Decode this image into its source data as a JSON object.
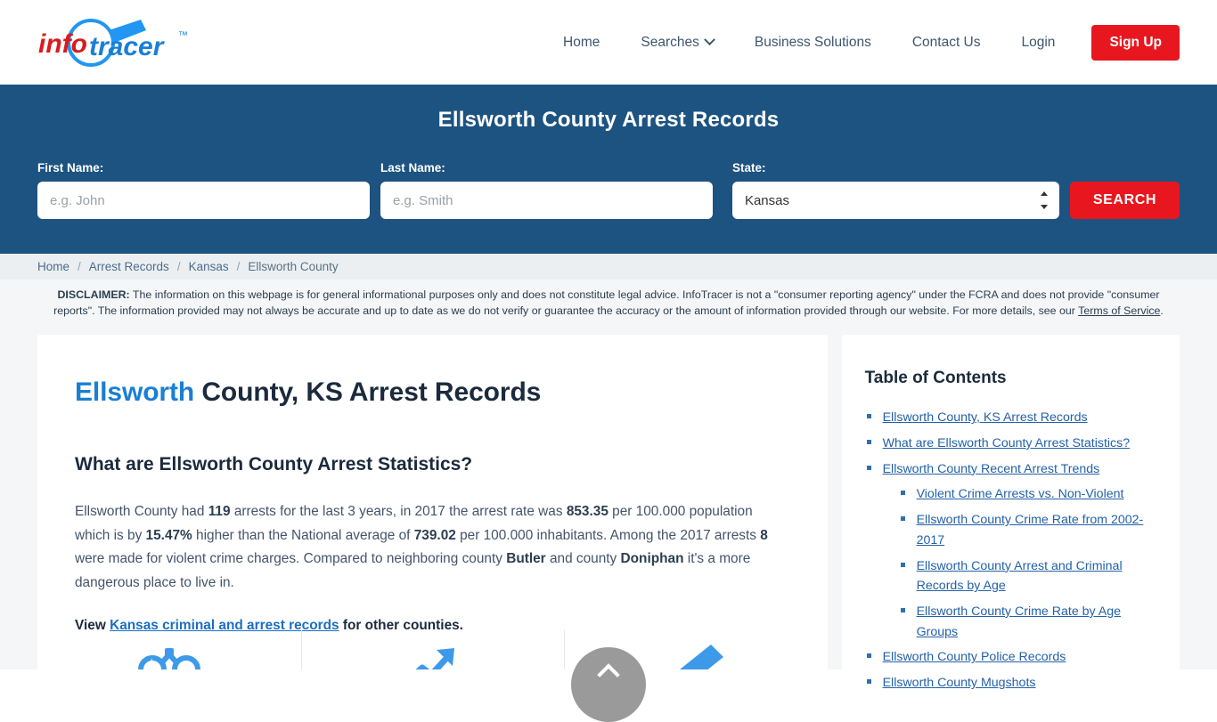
{
  "brand": {
    "name_info": "info",
    "name_tracer": "tracer",
    "tm": "™"
  },
  "nav": {
    "items": [
      {
        "label": "Home",
        "icon": null
      },
      {
        "label": "Searches",
        "icon": "chevron-down-icon"
      },
      {
        "label": "Business Solutions",
        "icon": null
      },
      {
        "label": "Contact Us",
        "icon": null
      },
      {
        "label": "Login",
        "icon": null
      }
    ],
    "signup_label": "Sign Up"
  },
  "search_band": {
    "title": "Ellsworth County Arrest Records",
    "first_name_label": "First Name:",
    "first_name_placeholder": "e.g. John",
    "first_name_value": "",
    "last_name_label": "Last Name:",
    "last_name_placeholder": "e.g. Smith",
    "last_name_value": "",
    "state_label": "State:",
    "state_selected": "Kansas",
    "state_options": [
      "Kansas"
    ],
    "search_button": "SEARCH",
    "background_color": "#1d5381",
    "button_color": "#e8171f"
  },
  "breadcrumb": {
    "items": [
      "Home",
      "Arrest Records",
      "Kansas",
      "Ellsworth County"
    ],
    "separator": "/"
  },
  "disclaimer": {
    "label": "DISCLAIMER:",
    "text_part1": " The information on this webpage is for general informational purposes only and does not constitute legal advice. InfoTracer is not a \"consumer reporting agency\" under the FCRA and does not provide \"consumer reports\". The information provided may not always be accurate and up to date as we do not verify or guarantee the accuracy or the amount of information provided through our website. For more details, see our ",
    "link": "Terms of Service",
    "text_part2": "."
  },
  "main": {
    "title_highlight": "Ellsworth",
    "title_rest": " County, KS Arrest Records",
    "section_heading": "What are Ellsworth County Arrest Statistics?",
    "stats": {
      "arrests_count": "119",
      "arrest_rate_2017": "853.35",
      "percent_higher": "15.47%",
      "national_average": "739.02",
      "violent_arrests": "8",
      "neighbor_county_1": "Butler",
      "neighbor_county_2": "Doniphan"
    },
    "paragraph": {
      "p1": "Ellsworth County had ",
      "p2": " arrests for the last 3 years, in 2017 the arrest rate was ",
      "p3": " per 100.000 population which is by ",
      "p4": " higher than the National average of ",
      "p5": " per 100.000 inhabitants. Among the 2017 arrests ",
      "p6": " were made for violent crime charges. Compared to neighboring county ",
      "p7": " and county ",
      "p8": " it's a more dangerous place to live in."
    },
    "view_line": {
      "prefix": "View ",
      "link": "Kansas criminal and arrest records",
      "suffix": " for other counties."
    },
    "feature_icons": [
      {
        "name": "handcuffs-icon"
      },
      {
        "name": "trend-arrow-icon"
      },
      {
        "name": "pen-icon"
      }
    ]
  },
  "sidebar": {
    "title": "Table of Contents",
    "items": [
      {
        "label": "Ellsworth County, KS Arrest Records",
        "level": 1
      },
      {
        "label": "What are Ellsworth County Arrest Statistics?",
        "level": 1
      },
      {
        "label": "Ellsworth County Recent Arrest Trends",
        "level": 1
      },
      {
        "label": "Violent Crime Arrests vs. Non-Violent",
        "level": 2
      },
      {
        "label": "Ellsworth County Crime Rate from 2002-2017",
        "level": 2
      },
      {
        "label": "Ellsworth County Arrest and Criminal Records by Age",
        "level": 2
      },
      {
        "label": "Ellsworth County Crime Rate by Age Groups",
        "level": 2
      },
      {
        "label": "Ellsworth County Police Records",
        "level": 1
      },
      {
        "label": "Ellsworth County Mugshots",
        "level": 1
      }
    ]
  },
  "scroll_top": {
    "icon": "chevron-up-icon"
  }
}
